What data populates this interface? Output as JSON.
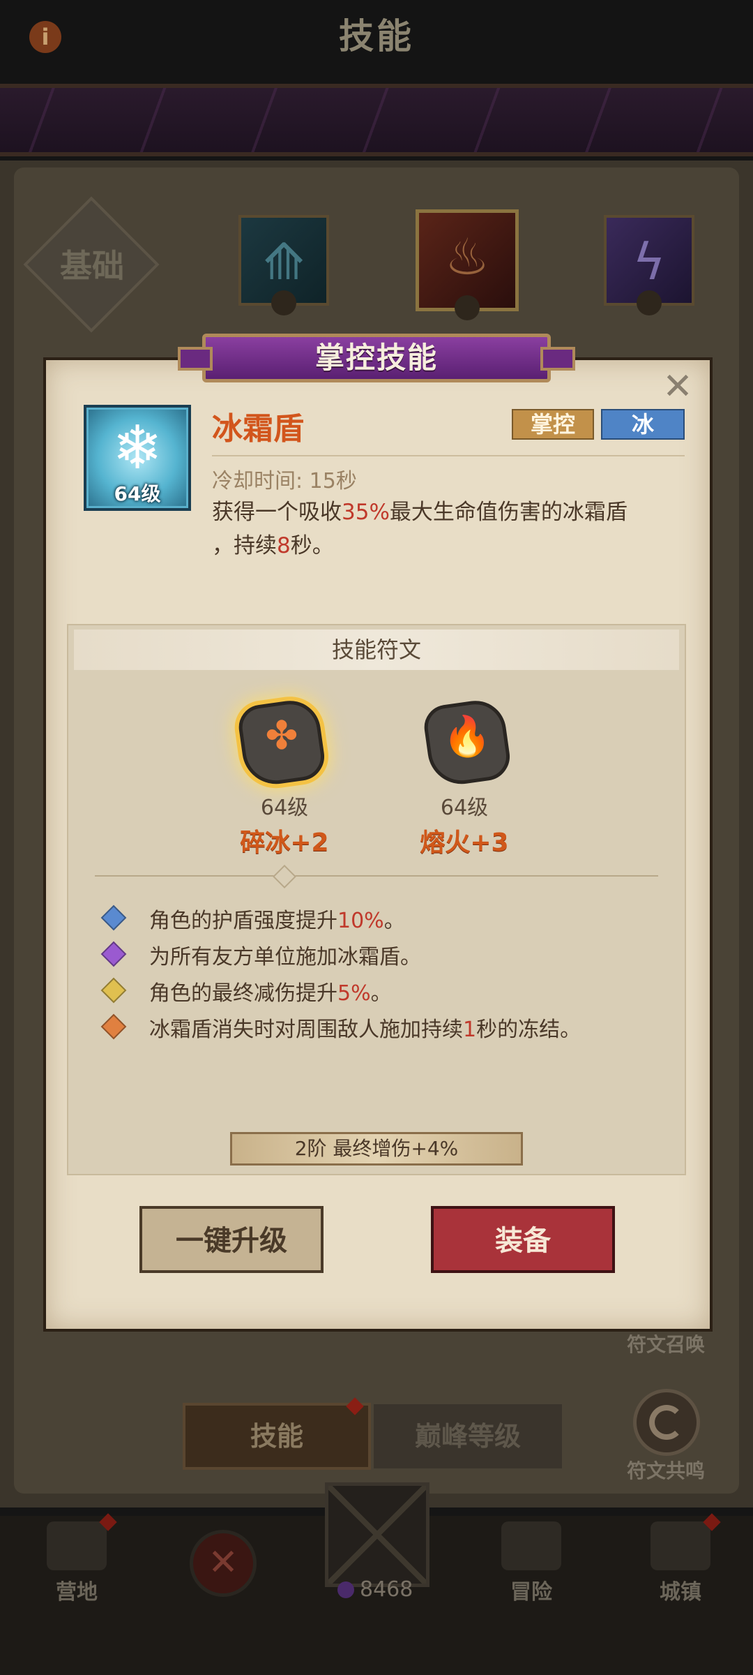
{
  "header": {
    "title": "技能",
    "info_icon": "info-icon"
  },
  "tabs": {
    "basic_label": "基础",
    "skill_tabs": [
      {
        "element": "ice",
        "icon": "ice-trident-icon"
      },
      {
        "element": "fire",
        "icon": "fire-claw-icon",
        "selected": true
      },
      {
        "element": "arcane",
        "icon": "lightning-icon"
      }
    ]
  },
  "dialog": {
    "title": "掌控技能",
    "close_glyph": "✕",
    "skill": {
      "name": "冰霜盾",
      "level": "64级",
      "icon": "snowflake-icon",
      "tags": [
        "掌控",
        "冰"
      ],
      "cooldown": "冷却时间: 15秒",
      "description": {
        "line1_before": "获得一个吸收",
        "line1_value": "35%",
        "line1_after": "最大生命值伤害的冰霜盾",
        "line2_before": "，持续",
        "line2_value": "8",
        "line2_after": "秒。"
      }
    },
    "runes": {
      "title": "技能符文",
      "items": [
        {
          "level": "64级",
          "name": "碎冰+2",
          "icon": "shatter-clover-icon",
          "glyph": "✤",
          "selected": true
        },
        {
          "level": "64级",
          "name": "熔火+3",
          "icon": "flame-icon",
          "glyph": "🔥",
          "selected": false
        }
      ],
      "effects": [
        {
          "color": "blue",
          "before": "角色的护盾强度提升",
          "value": "10%",
          "after": "。"
        },
        {
          "color": "purple",
          "before": "为所有友方单位施加冰霜盾。",
          "value": "",
          "after": ""
        },
        {
          "color": "yellow",
          "before": "角色的最终减伤提升",
          "value": "5%",
          "after": "。"
        },
        {
          "color": "orange",
          "before": "冰霜盾消失时对周围敌人施加持续",
          "value": "1",
          "after": "秒的冻结。"
        }
      ],
      "tier": "2阶 最终增伤+4%"
    },
    "buttons": {
      "upgrade": "一键升级",
      "equip": "装备"
    }
  },
  "side": {
    "rune_summon": "符文召唤",
    "rune_resonance": "符文共鸣"
  },
  "bottom_switch": {
    "skills": "技能",
    "peak_level": "巅峰等级"
  },
  "nav": {
    "camp": "营地",
    "adventure": "冒险",
    "town": "城镇",
    "crystal_count": "8468"
  },
  "colors": {
    "highlight": "#c0392b",
    "skill_name": "#d2551c",
    "equip": "#a9333a",
    "dialog_bg": "#e8ddc6"
  }
}
